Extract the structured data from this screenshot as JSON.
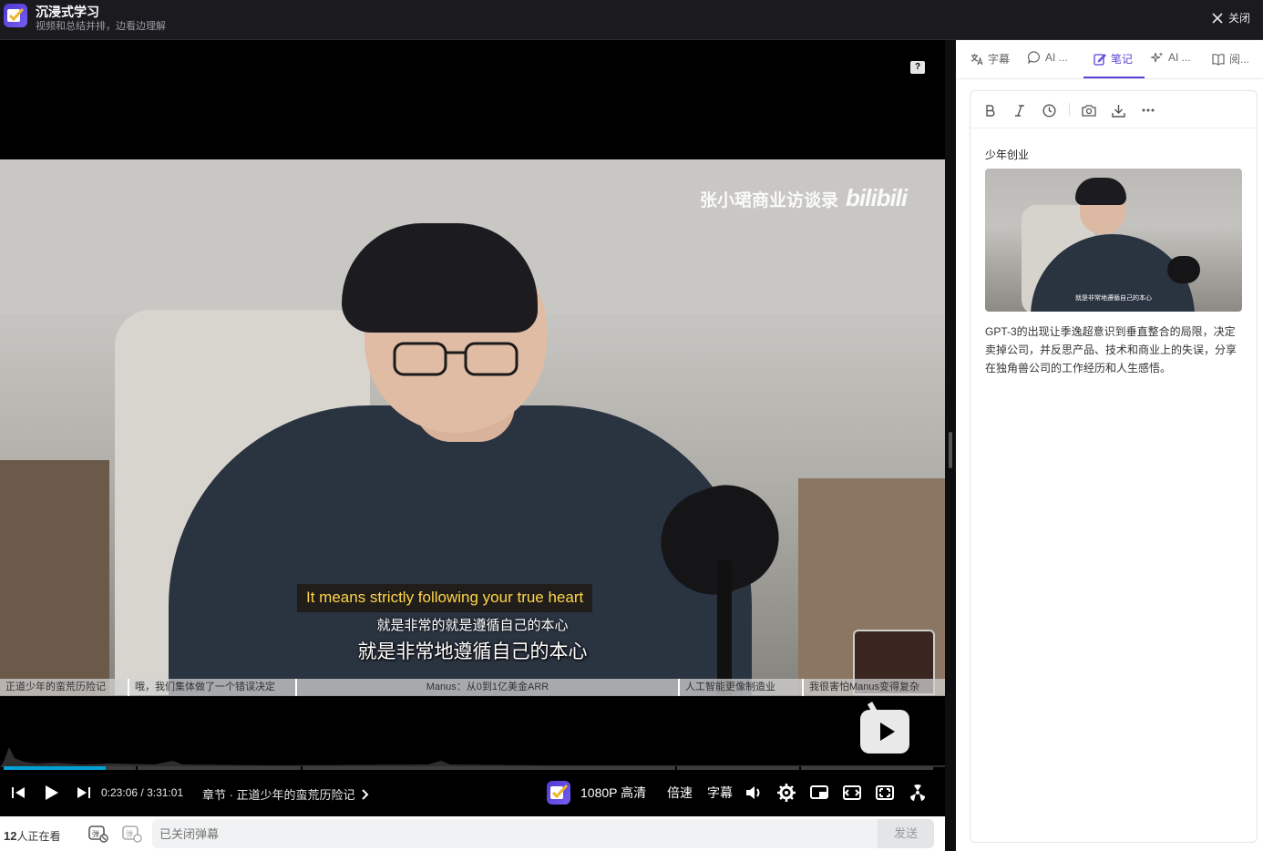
{
  "header": {
    "title": "沉浸式学习",
    "subtitle": "视频和总结并排，边看边理解",
    "close_label": "关闭"
  },
  "video": {
    "watermark_text": "张小珺商业访谈录",
    "watermark_brand": "bilibili",
    "subtitle_en": "It means strictly following your true heart",
    "subtitle_cn_small": "就是非常的就是遵循自己的本心",
    "subtitle_cn_large": "就是非常地遵循自己的本心",
    "chapters": [
      "正道少年的蛮荒历险记",
      "哦，我们集体做了一个错误决定",
      "Manus：从0到1亿美金ARR",
      "人工智能更像制造业",
      "我很害怕Manus变得复杂"
    ],
    "progress_fraction": 0.1096
  },
  "controls": {
    "current_time": "0:23:06",
    "separator": "/",
    "duration": "3:31:01",
    "chapter_label": "章节 · 正道少年的蛮荒历险记",
    "quality_label": "1080P 高清",
    "speed_label": "倍速",
    "subtitle_label": "字幕"
  },
  "bottom": {
    "viewer_count": "12",
    "viewer_suffix": "人正在看",
    "danmaku_placeholder": "已关闭弹幕",
    "send_label": "发送"
  },
  "panel": {
    "tabs": [
      {
        "label": "字幕",
        "icon": "translate-icon"
      },
      {
        "label": "AI ...",
        "icon": "chat-bubble-icon"
      },
      {
        "label": "笔记",
        "icon": "note-edit-icon"
      },
      {
        "label": "AI ...",
        "icon": "sparkle-icon"
      },
      {
        "label": "阅...",
        "icon": "book-icon"
      }
    ],
    "active_tab": "笔记",
    "note": {
      "heading": "少年创业",
      "thumbnail_subtitle": "就是非常地遵循自己的本心",
      "body": "GPT-3的出现让季逸超意识到垂直整合的局限，决定卖掉公司，并反思产品、技术和商业上的失误，分享在独角兽公司的工作经历和人生感悟。"
    }
  },
  "colors": {
    "accent": "#5a3fd6",
    "progress": "#00a1d6",
    "subtitle_en": "#ffd54a"
  }
}
